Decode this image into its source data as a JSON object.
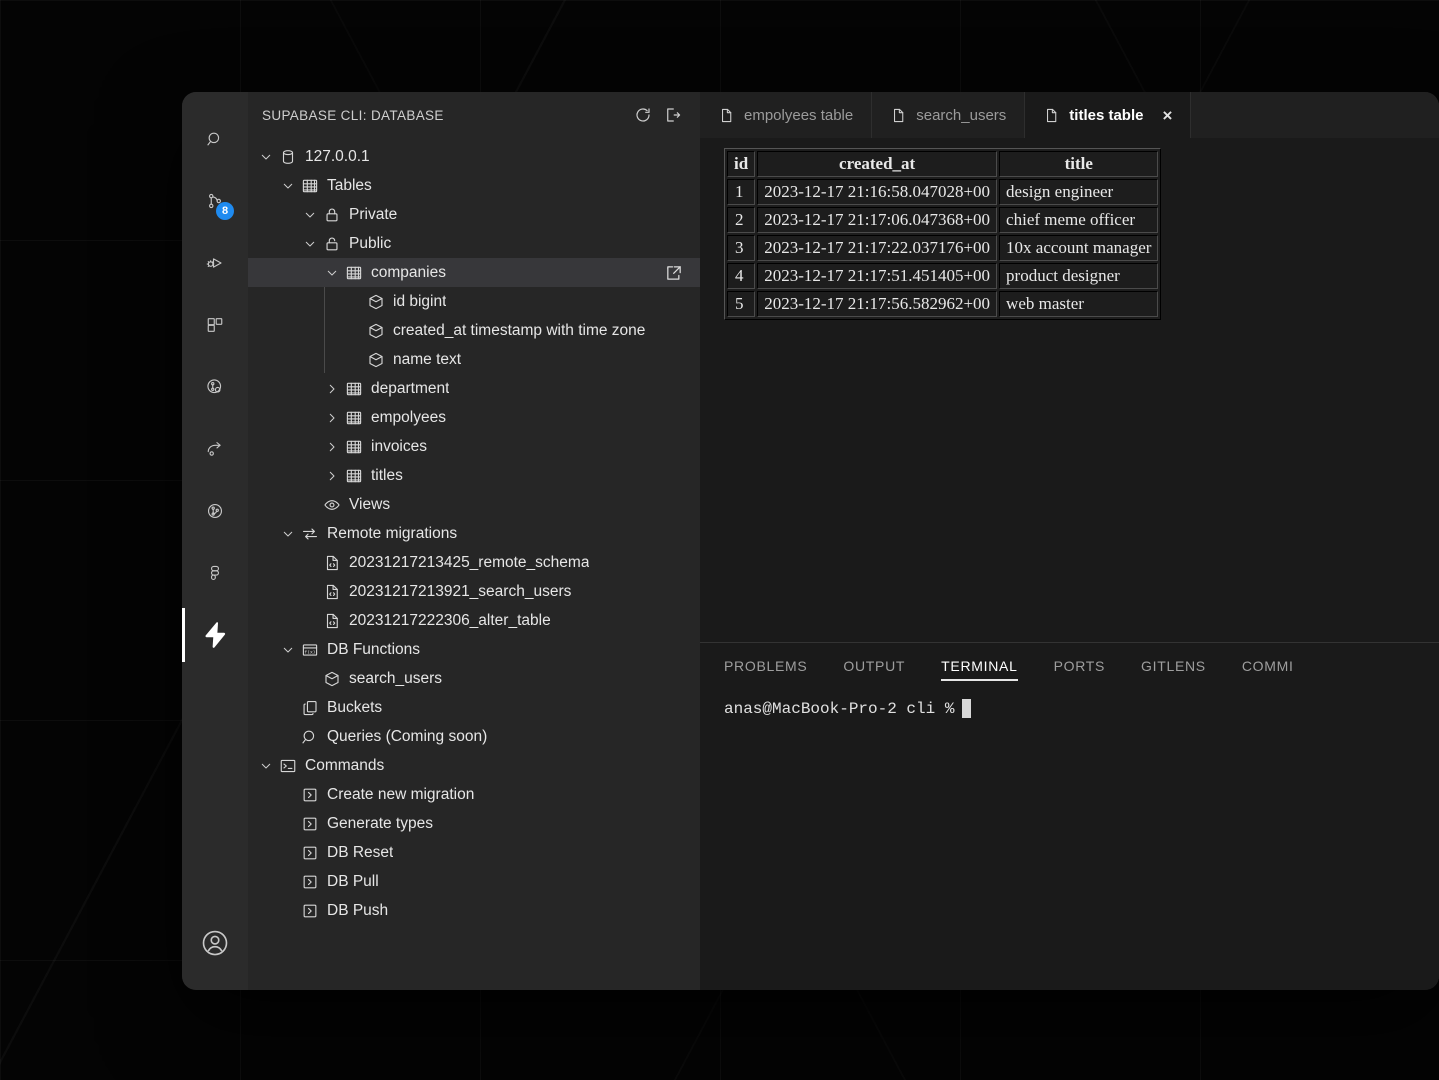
{
  "colors": {
    "accent_badge": "#1f8bf0",
    "window_bg": "#1f1f1f",
    "sidebar_bg": "#262626",
    "editor_bg": "#1a1a1a",
    "activity_bg": "#2b2b2b",
    "selected_row": "#37373a"
  },
  "activity_bar": {
    "items": [
      {
        "name": "search-icon",
        "label": "Search",
        "active": false,
        "badge": null
      },
      {
        "name": "source-control-icon",
        "label": "Source Control",
        "active": false,
        "badge": "8"
      },
      {
        "name": "run-and-debug-icon",
        "label": "Run and Debug",
        "active": false,
        "badge": null
      },
      {
        "name": "extensions-icon",
        "label": "Extensions",
        "active": false,
        "badge": null
      },
      {
        "name": "git-graph-icon",
        "label": "Git Graph",
        "active": false,
        "badge": null
      },
      {
        "name": "share-icon",
        "label": "Share",
        "active": false,
        "badge": null
      },
      {
        "name": "gitlens-icon",
        "label": "GitLens",
        "active": false,
        "badge": null
      },
      {
        "name": "figma-icon",
        "label": "Figma",
        "active": false,
        "badge": null
      },
      {
        "name": "supabase-icon",
        "label": "Supabase",
        "active": true,
        "badge": null
      }
    ],
    "account": {
      "name": "account-icon",
      "label": "Accounts"
    }
  },
  "sidebar": {
    "title": "SUPABASE CLI: DATABASE",
    "actions": [
      {
        "name": "refresh-icon",
        "label": "Refresh"
      },
      {
        "name": "logout-icon",
        "label": "Log out"
      }
    ],
    "tree": [
      {
        "label": "127.0.0.1",
        "icon": "database-icon",
        "twisty": "down",
        "indent": 0,
        "selected": false,
        "action": null
      },
      {
        "label": "Tables",
        "icon": "table-icon",
        "twisty": "down",
        "indent": 1,
        "selected": false,
        "action": null
      },
      {
        "label": "Private",
        "icon": "lock-icon",
        "twisty": "down",
        "indent": 2,
        "selected": false,
        "action": null
      },
      {
        "label": "Public",
        "icon": "unlock-icon",
        "twisty": "down",
        "indent": 2,
        "selected": false,
        "action": null
      },
      {
        "label": "companies",
        "icon": "table-icon",
        "twisty": "down",
        "indent": 3,
        "selected": true,
        "action": "open-external-icon"
      },
      {
        "label": "id bigint",
        "icon": "column-icon",
        "twisty": "none",
        "indent": 4,
        "selected": false,
        "action": null
      },
      {
        "label": "created_at timestamp with time zone",
        "icon": "column-icon",
        "twisty": "none",
        "indent": 4,
        "selected": false,
        "action": null
      },
      {
        "label": "name text",
        "icon": "column-icon",
        "twisty": "none",
        "indent": 4,
        "selected": false,
        "action": null
      },
      {
        "label": "department",
        "icon": "table-icon",
        "twisty": "right",
        "indent": 3,
        "selected": false,
        "action": null
      },
      {
        "label": "empolyees",
        "icon": "table-icon",
        "twisty": "right",
        "indent": 3,
        "selected": false,
        "action": null
      },
      {
        "label": "invoices",
        "icon": "table-icon",
        "twisty": "right",
        "indent": 3,
        "selected": false,
        "action": null
      },
      {
        "label": "titles",
        "icon": "table-icon",
        "twisty": "right",
        "indent": 3,
        "selected": false,
        "action": null
      },
      {
        "label": "Views",
        "icon": "eye-icon",
        "twisty": "none",
        "indent": 2,
        "selected": false,
        "action": null
      },
      {
        "label": "Remote migrations",
        "icon": "sync-icon",
        "twisty": "down",
        "indent": 1,
        "selected": false,
        "action": null
      },
      {
        "label": "20231217213425_remote_schema",
        "icon": "file-code-icon",
        "twisty": "none",
        "indent": 2,
        "selected": false,
        "action": null
      },
      {
        "label": "20231217213921_search_users",
        "icon": "file-code-icon",
        "twisty": "none",
        "indent": 2,
        "selected": false,
        "action": null
      },
      {
        "label": "20231217222306_alter_table",
        "icon": "file-code-icon",
        "twisty": "none",
        "indent": 2,
        "selected": false,
        "action": null
      },
      {
        "label": "DB Functions",
        "icon": "function-icon",
        "twisty": "down",
        "indent": 1,
        "selected": false,
        "action": null
      },
      {
        "label": "search_users",
        "icon": "column-icon",
        "twisty": "none",
        "indent": 2,
        "selected": false,
        "action": null
      },
      {
        "label": "Buckets",
        "icon": "buckets-icon",
        "twisty": "none",
        "indent": 1,
        "selected": false,
        "action": null
      },
      {
        "label": "Queries (Coming soon)",
        "icon": "search-icon",
        "twisty": "none",
        "indent": 1,
        "selected": false,
        "action": null
      },
      {
        "label": "Commands",
        "icon": "terminal-icon",
        "twisty": "down",
        "indent": 0,
        "selected": false,
        "action": null
      },
      {
        "label": "Create new migration",
        "icon": "run-icon",
        "twisty": "none",
        "indent": 1,
        "selected": false,
        "action": null
      },
      {
        "label": "Generate types",
        "icon": "run-icon",
        "twisty": "none",
        "indent": 1,
        "selected": false,
        "action": null
      },
      {
        "label": "DB Reset",
        "icon": "run-icon",
        "twisty": "none",
        "indent": 1,
        "selected": false,
        "action": null
      },
      {
        "label": "DB Pull",
        "icon": "run-icon",
        "twisty": "none",
        "indent": 1,
        "selected": false,
        "action": null
      },
      {
        "label": "DB Push",
        "icon": "run-icon",
        "twisty": "none",
        "indent": 1,
        "selected": false,
        "action": null
      }
    ]
  },
  "editor": {
    "tabs": [
      {
        "label": "empolyees table",
        "icon": "file-icon",
        "active": false,
        "closable": false
      },
      {
        "label": "search_users",
        "icon": "file-icon",
        "active": false,
        "closable": false
      },
      {
        "label": "titles table",
        "icon": "file-icon",
        "active": true,
        "closable": true
      }
    ],
    "close_label": "×",
    "table": {
      "columns": [
        "id",
        "created_at",
        "title"
      ],
      "rows": [
        [
          "1",
          "2023-12-17 21:16:58.047028+00",
          "design engineer"
        ],
        [
          "2",
          "2023-12-17 21:17:06.047368+00",
          "chief meme officer"
        ],
        [
          "3",
          "2023-12-17 21:17:22.037176+00",
          "10x account manager"
        ],
        [
          "4",
          "2023-12-17 21:17:51.451405+00",
          "product designer"
        ],
        [
          "5",
          "2023-12-17 21:17:56.582962+00",
          "web master"
        ]
      ]
    }
  },
  "panel": {
    "tabs": [
      {
        "label": "PROBLEMS",
        "active": false
      },
      {
        "label": "OUTPUT",
        "active": false
      },
      {
        "label": "TERMINAL",
        "active": true
      },
      {
        "label": "PORTS",
        "active": false
      },
      {
        "label": "GITLENS",
        "active": false
      },
      {
        "label": "COMMI",
        "active": false
      }
    ],
    "terminal": {
      "prompt": "anas@MacBook-Pro-2 cli % "
    }
  }
}
